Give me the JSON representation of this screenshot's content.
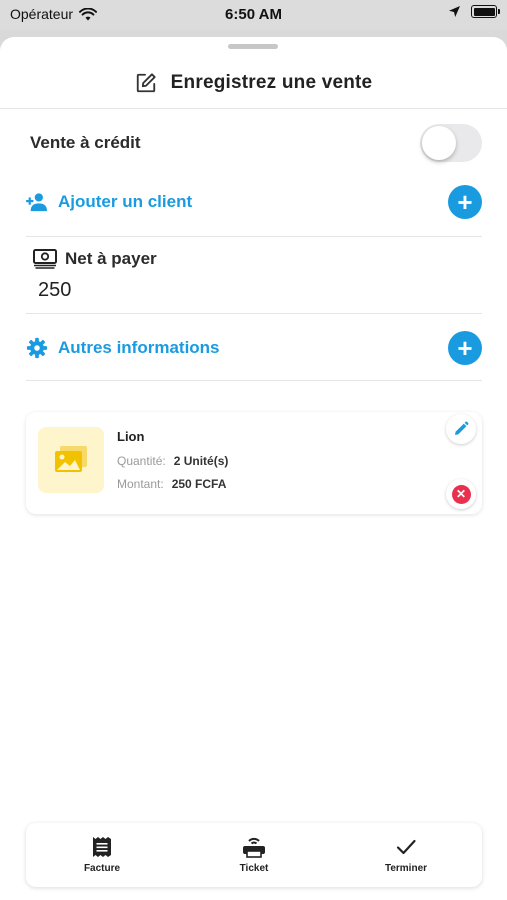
{
  "status_bar": {
    "carrier": "Opérateur",
    "time": "6:50 AM",
    "icons": [
      "wifi-icon",
      "location-arrow-icon",
      "battery-icon"
    ]
  },
  "header": {
    "title": "Enregistrez une vente",
    "icon": "edit-note-icon"
  },
  "credit": {
    "label": "Vente à crédit",
    "enabled": false
  },
  "add_client": {
    "label": "Ajouter un client",
    "icon": "add-person-icon"
  },
  "net": {
    "label": "Net à payer",
    "value": "250",
    "icon": "cash-icon"
  },
  "other_info": {
    "label": "Autres informations",
    "icon": "gear-icon"
  },
  "product": {
    "name": "Lion",
    "quantity_label": "Quantité:",
    "quantity_value": "2 Unité(s)",
    "amount_label": "Montant:",
    "amount_value": "250 FCFA",
    "thumbnail_icon": "image-placeholder-icon"
  },
  "bottom_bar": {
    "invoice_label": "Facture",
    "ticket_label": "Ticket",
    "finish_label": "Terminer"
  },
  "colors": {
    "accent": "#1a9be0",
    "danger": "#e8304f",
    "thumbnail_bg": "#fff5cc",
    "thumbnail_icon": "#f2c200"
  }
}
